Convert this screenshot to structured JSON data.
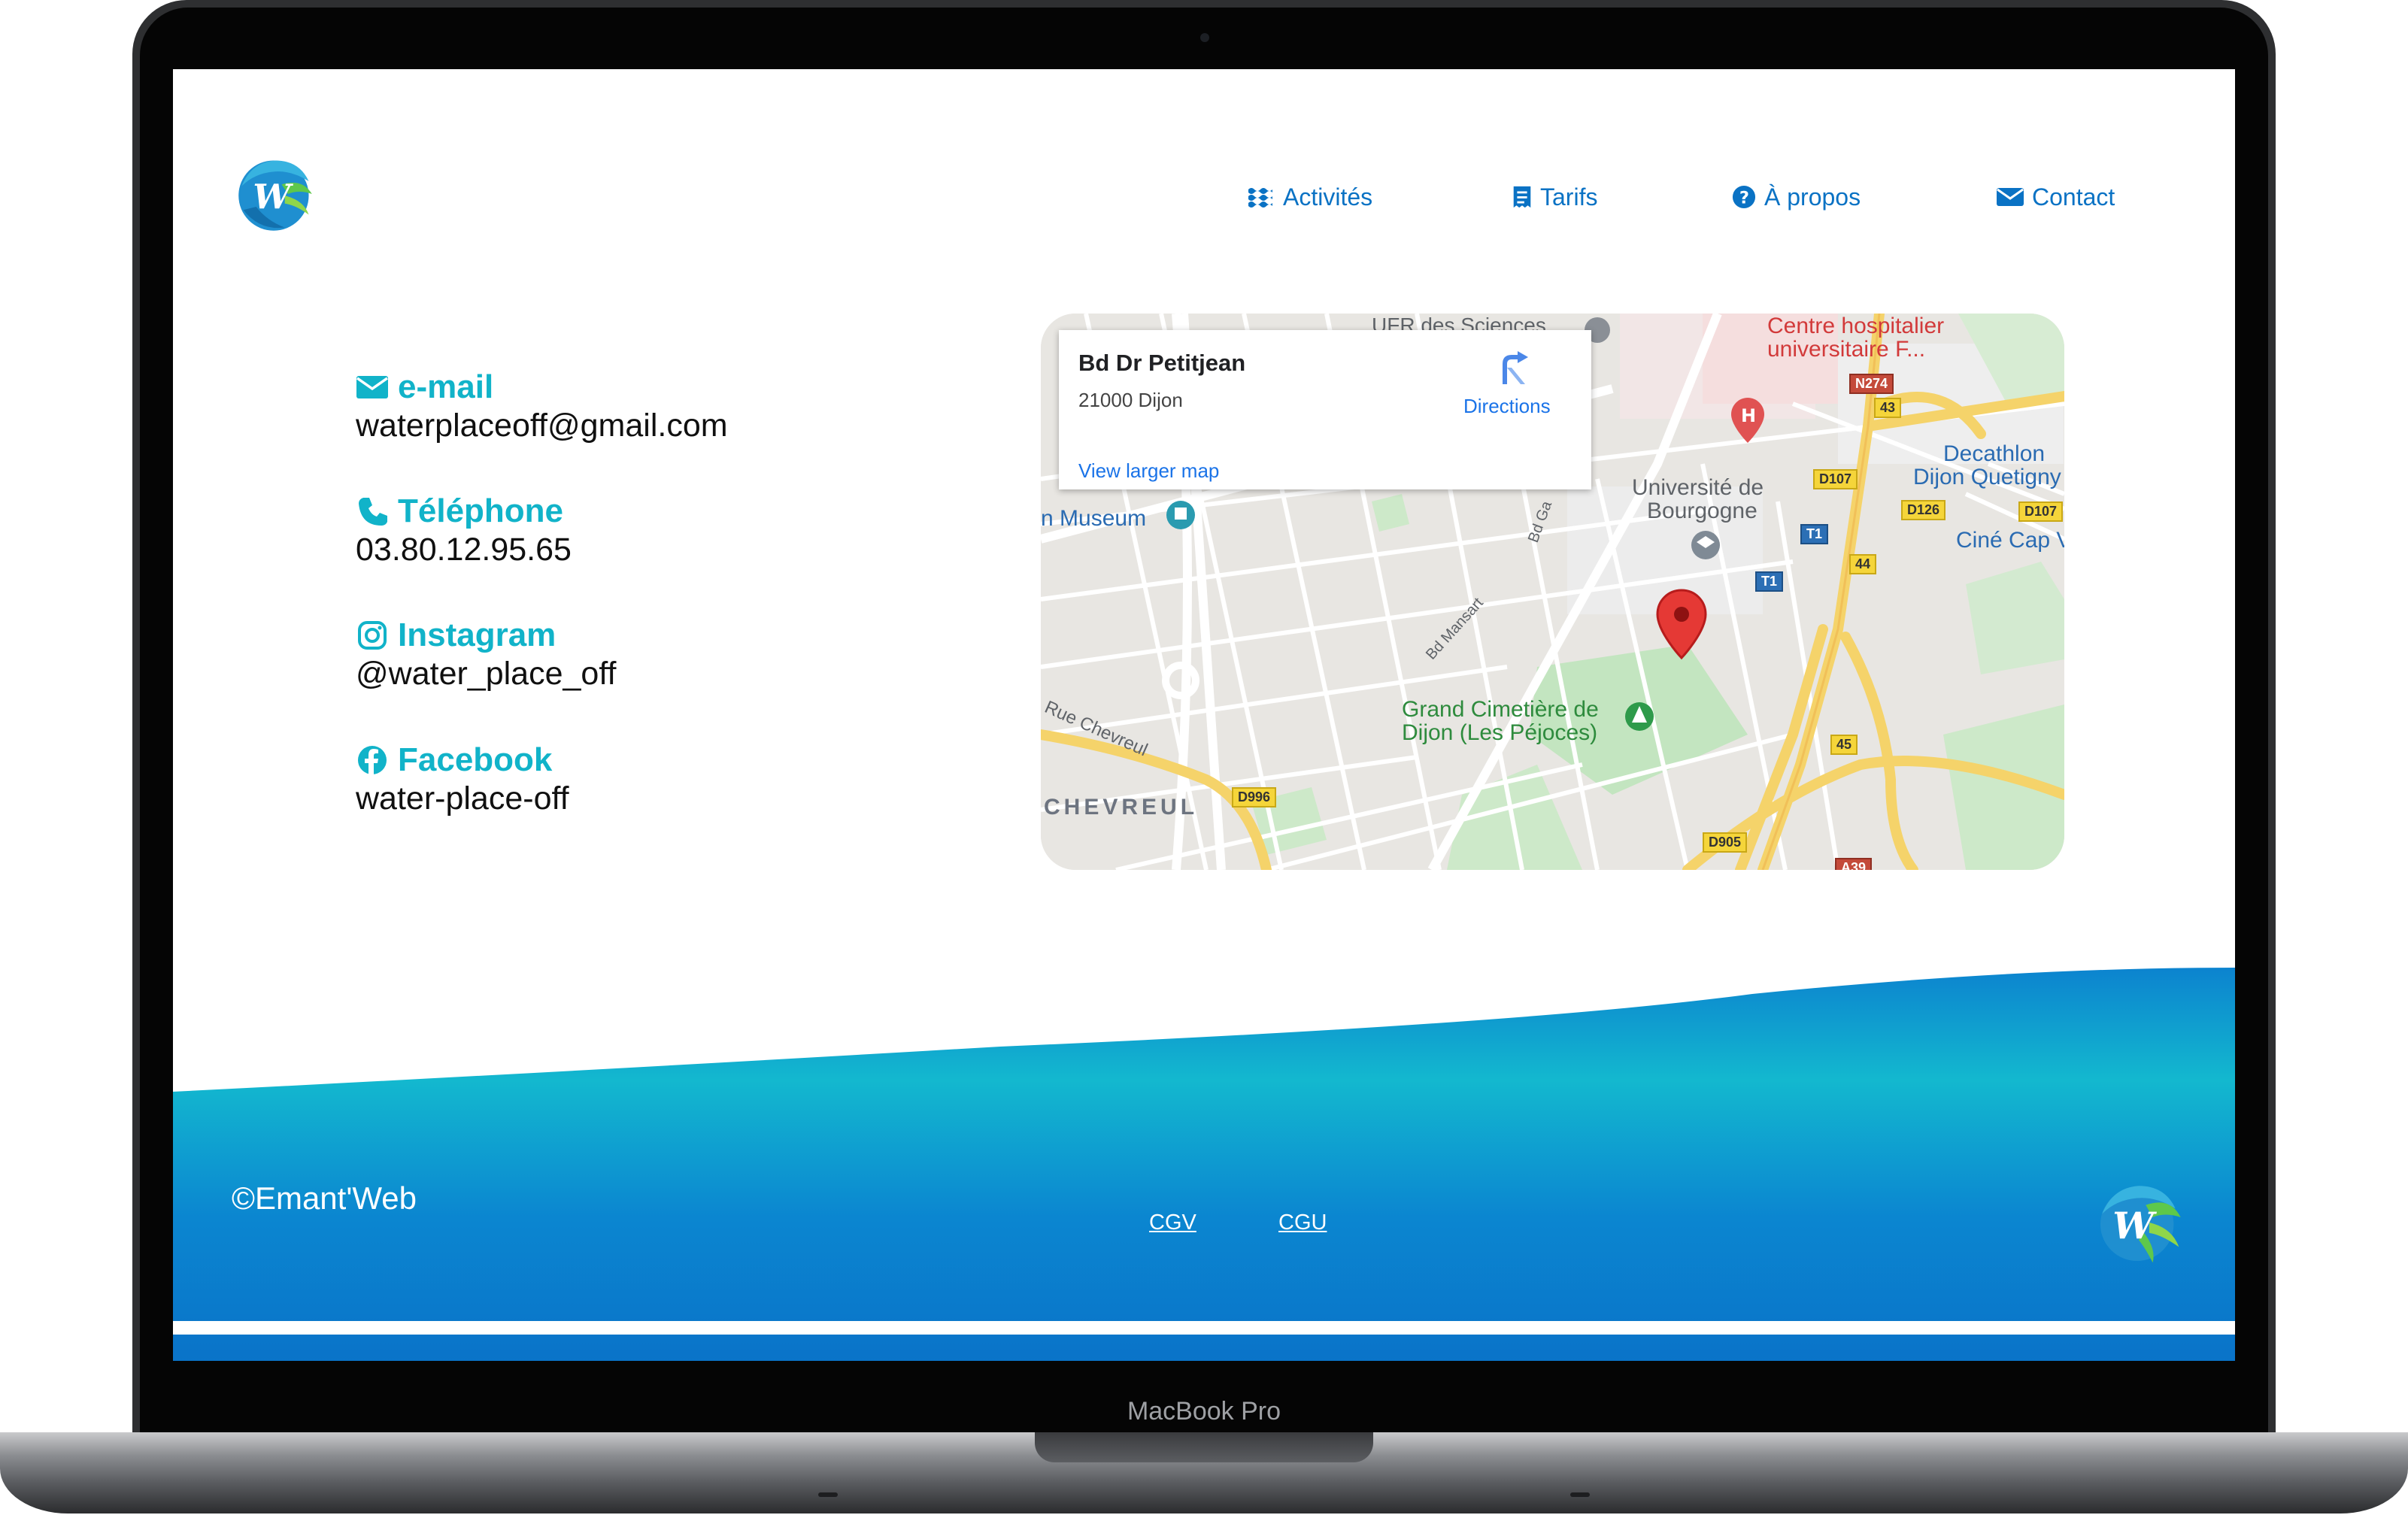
{
  "device": {
    "label": "MacBook Pro"
  },
  "nav": {
    "items": [
      {
        "label": "Activités",
        "icon": "waves-icon"
      },
      {
        "label": "Tarifs",
        "icon": "receipt-icon"
      },
      {
        "label": "À propos",
        "icon": "question-circle-icon"
      },
      {
        "label": "Contact",
        "icon": "envelope-icon"
      }
    ]
  },
  "contact": {
    "email": {
      "title": "e-mail",
      "value": "waterplaceoff@gmail.com"
    },
    "phone": {
      "title": "Téléphone",
      "value": "03.80.12.95.65"
    },
    "instagram": {
      "title": "Instagram",
      "value": "@water_place_off"
    },
    "facebook": {
      "title": "Facebook",
      "value": "water-place-off"
    }
  },
  "map": {
    "place_name": "Bd Dr Petitjean",
    "address": "21000 Dijon",
    "directions_label": "Directions",
    "larger_map_label": "View larger map",
    "labels": {
      "ufr": "UFR des Sciences",
      "hospital_1": "Centre hospitalier",
      "hospital_2": "universitaire F...",
      "decathlon_1": "Decathlon",
      "decathlon_2": "Dijon Quetigny",
      "cine": "Ciné Cap V",
      "universite_1": "Université de",
      "universite_2": "Bourgogne",
      "museum": "n Museum",
      "cimetiere_1": "Grand Cimetière de",
      "cimetiere_2": "Dijon (Les Péjoces)",
      "rue_chevreul": "Rue Chevreul",
      "chevreul": "CHEVREUL",
      "bd_mansart": "Bd Mansart",
      "bd_ga": "Bd Ga"
    },
    "shields": {
      "n274": "N274",
      "s43": "43",
      "d107a": "D107",
      "d107b": "D107",
      "d126": "D126",
      "t1a": "T1",
      "t1b": "T1",
      "s44": "44",
      "s45": "45",
      "d996": "D996",
      "d905": "D905",
      "a39": "A39"
    }
  },
  "footer": {
    "copyright": "©Emant'Web",
    "links": [
      "CGV",
      "CGU"
    ]
  },
  "colors": {
    "accent": "#11b3c9",
    "nav": "#0a72c4",
    "wave_top": "#14bccd",
    "wave_bottom": "#0b74c9"
  }
}
